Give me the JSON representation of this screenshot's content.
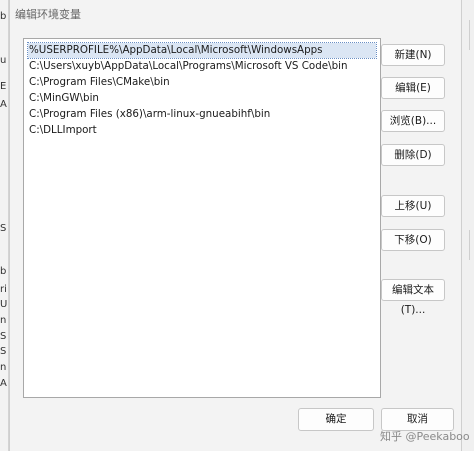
{
  "background_fragments": [
    "b",
    "u",
    "E",
    "A",
    "S",
    "b",
    "ri",
    "U",
    "n",
    "S",
    "S",
    "n",
    "A"
  ],
  "dialog": {
    "title": "编辑环境变量",
    "entries": [
      "%USERPROFILE%\\AppData\\Local\\Microsoft\\WindowsApps",
      "C:\\Users\\xuyb\\AppData\\Local\\Programs\\Microsoft VS Code\\bin",
      "C:\\Program Files\\CMake\\bin",
      "C:\\MinGW\\bin",
      "C:\\Program Files (x86)\\arm-linux-gnueabihf\\bin",
      "C:\\DLLImport"
    ],
    "buttons": {
      "new": "新建(N)",
      "edit": "编辑(E)",
      "browse": "浏览(B)...",
      "delete": "删除(D)",
      "move_up": "上移(U)",
      "move_down": "下移(O)",
      "edit_text": "编辑文本(T)...",
      "ok": "确定",
      "cancel": "取消"
    }
  },
  "watermark": "知乎 @Peekaboo",
  "colors": {
    "selection": "#dbe6f4",
    "dialog_bg": "#f3f3f3",
    "list_bg": "#ffffff"
  }
}
